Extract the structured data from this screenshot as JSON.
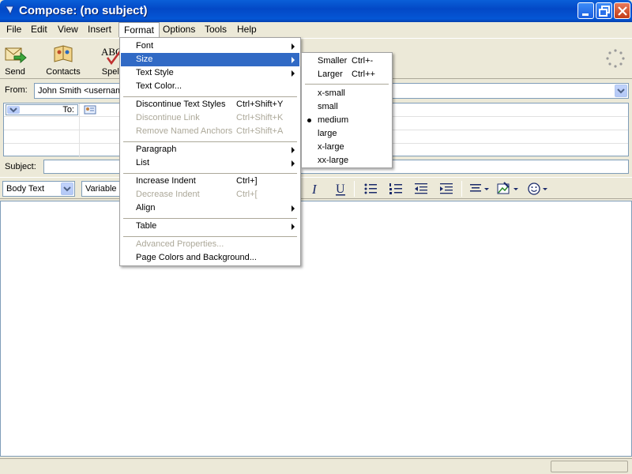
{
  "window": {
    "title": "Compose: (no subject)"
  },
  "menubar": {
    "items": [
      {
        "label": "File"
      },
      {
        "label": "Edit"
      },
      {
        "label": "View"
      },
      {
        "label": "Insert"
      },
      {
        "label": "Format"
      },
      {
        "label": "Options"
      },
      {
        "label": "Tools"
      },
      {
        "label": "Help"
      }
    ]
  },
  "toolbar": {
    "send_label": "Send",
    "contacts_label": "Contacts",
    "spell_label": "Spell"
  },
  "compose": {
    "from_label": "From:",
    "from_value": "John Smith <usernam",
    "to_label": "To:",
    "subject_label": "Subject:",
    "subject_value": ""
  },
  "format_toolbar": {
    "paragraph_style": "Body Text",
    "font_width": "Variable"
  },
  "format_menu": {
    "items": [
      {
        "label": "Font",
        "shortcut": ""
      },
      {
        "label": "Size",
        "shortcut": ""
      },
      {
        "label": "Text Style",
        "shortcut": ""
      },
      {
        "label": "Text Color...",
        "shortcut": ""
      },
      {
        "label": "Discontinue Text Styles",
        "shortcut": "Ctrl+Shift+Y"
      },
      {
        "label": "Discontinue Link",
        "shortcut": "Ctrl+Shift+K"
      },
      {
        "label": "Remove Named Anchors",
        "shortcut": "Ctrl+Shift+A"
      },
      {
        "label": "Paragraph",
        "shortcut": ""
      },
      {
        "label": "List",
        "shortcut": ""
      },
      {
        "label": "Increase Indent",
        "shortcut": "Ctrl+]"
      },
      {
        "label": "Decrease Indent",
        "shortcut": "Ctrl+["
      },
      {
        "label": "Align",
        "shortcut": ""
      },
      {
        "label": "Table",
        "shortcut": ""
      },
      {
        "label": "Advanced Properties...",
        "shortcut": ""
      },
      {
        "label": "Page Colors and Background...",
        "shortcut": ""
      }
    ]
  },
  "size_menu": {
    "items": [
      {
        "label": "Smaller",
        "shortcut": "Ctrl+-"
      },
      {
        "label": "Larger",
        "shortcut": "Ctrl++"
      },
      {
        "label": "x-small",
        "shortcut": ""
      },
      {
        "label": "small",
        "shortcut": ""
      },
      {
        "label": "medium",
        "shortcut": ""
      },
      {
        "label": "large",
        "shortcut": ""
      },
      {
        "label": "x-large",
        "shortcut": ""
      },
      {
        "label": "xx-large",
        "shortcut": ""
      }
    ],
    "selected": "medium"
  },
  "colors": {
    "title_bar": "#0348C6",
    "menu_highlight": "#316AC5",
    "disabled_text": "#ACA899"
  }
}
